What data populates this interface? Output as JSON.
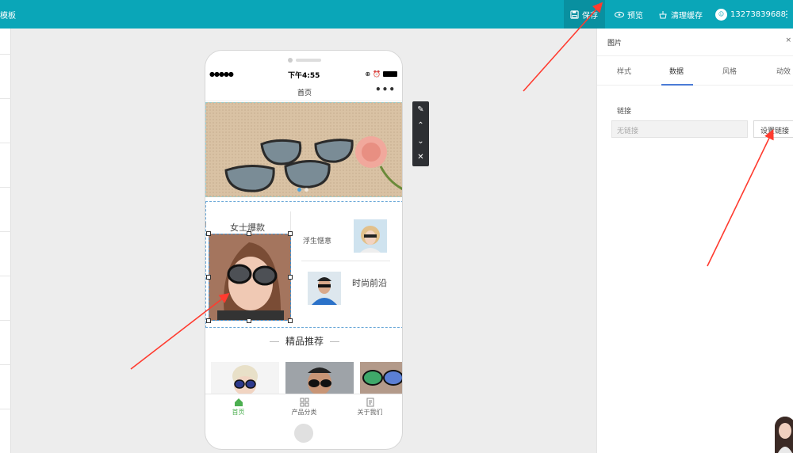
{
  "topbar": {
    "brand": "模板",
    "save_label": "保存",
    "preview_label": "预览",
    "clear_cache_label": "清理缓存",
    "user_phone": "13273839688",
    "accent": "#0aa6b8"
  },
  "phone": {
    "time": "下午4:55",
    "signal": "●●●●●",
    "title": "首页",
    "more": "•••",
    "banner_dots": 2,
    "active_dot": 0,
    "categories": {
      "women_hot": "女士爆款",
      "floating_life": "浮生惬意",
      "fashion_front": "时尚前沿"
    },
    "recommend_title": "精品推荐",
    "tabs": [
      {
        "label": "首页",
        "icon": "home-icon"
      },
      {
        "label": "产品分类",
        "icon": "grid-icon"
      },
      {
        "label": "关于我们",
        "icon": "document-icon"
      }
    ]
  },
  "panel": {
    "title": "图片",
    "close": "×",
    "tabs": [
      "样式",
      "数据",
      "风格",
      "动效"
    ],
    "active_tab": "数据",
    "link_label": "链接",
    "link_value": "无链接",
    "set_link_button": "设置链接"
  },
  "colors": {
    "arrow": "#ff3b2f",
    "active_tab": "#4caf50",
    "tab_underline": "#4a7bd6"
  }
}
